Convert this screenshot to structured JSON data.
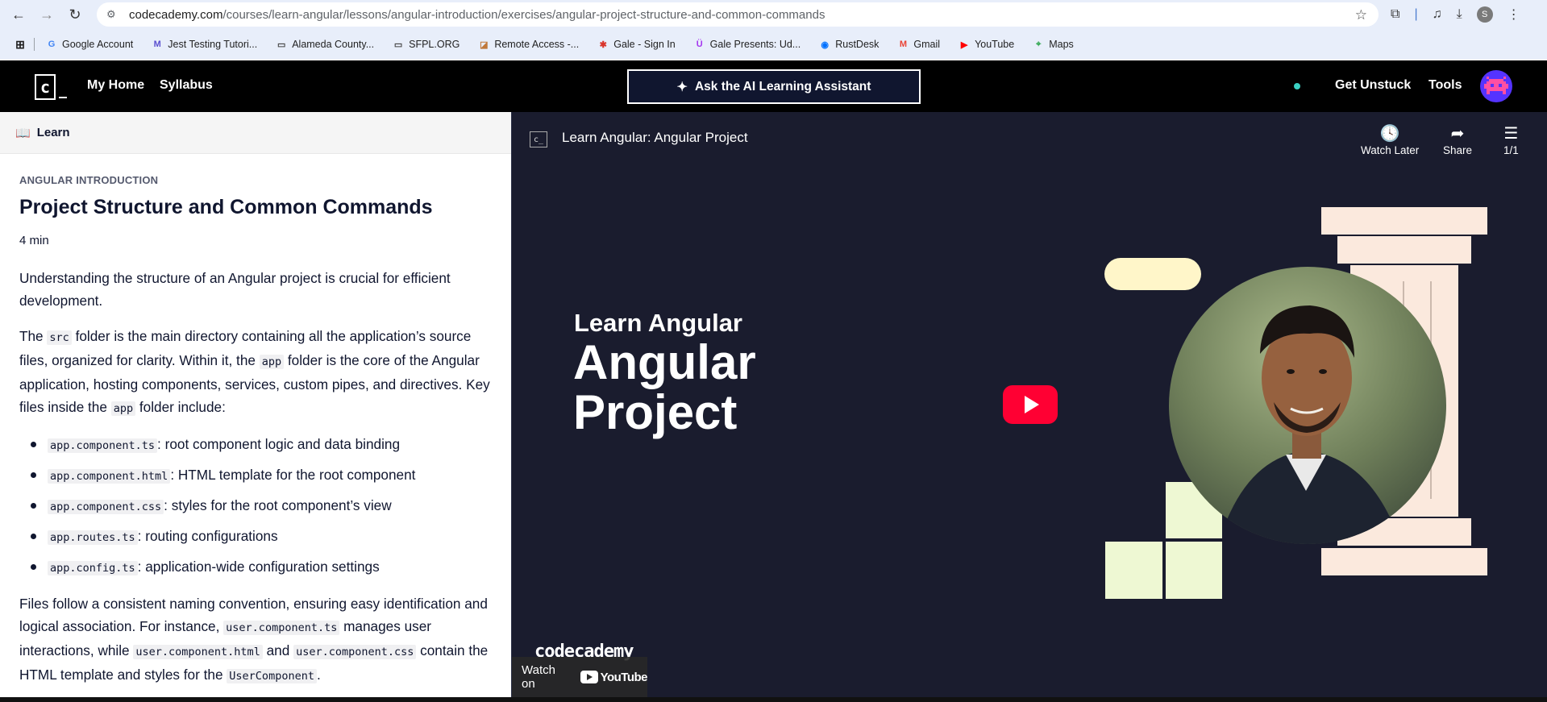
{
  "browser": {
    "url_host": "codecademy.com",
    "url_path": "/courses/learn-angular/lessons/angular-introduction/exercises/angular-project-structure-and-common-commands",
    "profile_initial": "S",
    "bookmarks": [
      {
        "label": "Google Account",
        "icon": "google-icon",
        "color": "#4285f4"
      },
      {
        "label": "Jest Testing Tutori...",
        "icon": "m-icon",
        "color": "#5a4fcf"
      },
      {
        "label": "Alameda County...",
        "icon": "folder-icon",
        "color": "#444"
      },
      {
        "label": "SFPL.ORG",
        "icon": "folder-icon",
        "color": "#444"
      },
      {
        "label": "Remote Access -...",
        "icon": "remote-icon",
        "color": "#c0783a"
      },
      {
        "label": "Gale - Sign In",
        "icon": "gale-icon",
        "color": "#d9342b"
      },
      {
        "label": "Gale Presents: Ud...",
        "icon": "udemy-icon",
        "color": "#a435f0"
      },
      {
        "label": "RustDesk",
        "icon": "rustdesk-icon",
        "color": "#0071ff"
      },
      {
        "label": "Gmail",
        "icon": "gmail-icon",
        "color": "#ea4335"
      },
      {
        "label": "YouTube",
        "icon": "youtube-icon",
        "color": "#ff0000"
      },
      {
        "label": "Maps",
        "icon": "maps-icon",
        "color": "#34a853"
      }
    ]
  },
  "header": {
    "nav_home": "My Home",
    "nav_syllabus": "Syllabus",
    "ai_button": "Ask the AI Learning Assistant",
    "get_unstuck": "Get Unstuck",
    "tools": "Tools"
  },
  "lesson": {
    "tab_label": "Learn",
    "kicker": "ANGULAR INTRODUCTION",
    "title": "Project Structure and Common Commands",
    "duration": "4 min",
    "intro": "Understanding the structure of an Angular project is crucial for efficient development.",
    "p2": {
      "a": "The ",
      "code1": "src",
      "b": " folder is the main directory containing all the application’s source files, organized for clarity. Within it, the ",
      "code2": "app",
      "c": " folder is the core of the Angular application, hosting components, services, custom pipes, and directives. Key files inside the ",
      "code3": "app",
      "d": " folder include:"
    },
    "files": [
      {
        "code": "app.component.ts",
        "desc": ": root component logic and data binding"
      },
      {
        "code": "app.component.html",
        "desc": ": HTML template for the root component"
      },
      {
        "code": "app.component.css",
        "desc": ": styles for the root component’s view"
      },
      {
        "code": "app.routes.ts",
        "desc": ": routing configurations"
      },
      {
        "code": "app.config.ts",
        "desc": ": application-wide configuration settings"
      }
    ],
    "p3": {
      "a": "Files follow a consistent naming convention, ensuring easy identification and logical association. For instance, ",
      "code1": "user.component.ts",
      "b": " manages user interactions, while ",
      "code2": "user.component.html",
      "c": " and ",
      "code3": "user.component.css",
      "d": " contain the HTML template and styles for the ",
      "code4": "UserComponent",
      "e": "."
    }
  },
  "video": {
    "title": "Learn Angular: Angular Project",
    "watch_later": "Watch Later",
    "share": "Share",
    "playlist_count": "1/1",
    "hero_small": "Learn Angular",
    "hero_line1": "Angular",
    "hero_line2": "Project",
    "watch_on": "Watch on",
    "youtube": "YouTube",
    "brand": "codecademy",
    "colors": {
      "bg": "#1a1c2e",
      "pillar": "#fbe9dd",
      "pill": "#fff6c9",
      "blocks": "#eef8d3",
      "play": "#ff0033"
    }
  }
}
